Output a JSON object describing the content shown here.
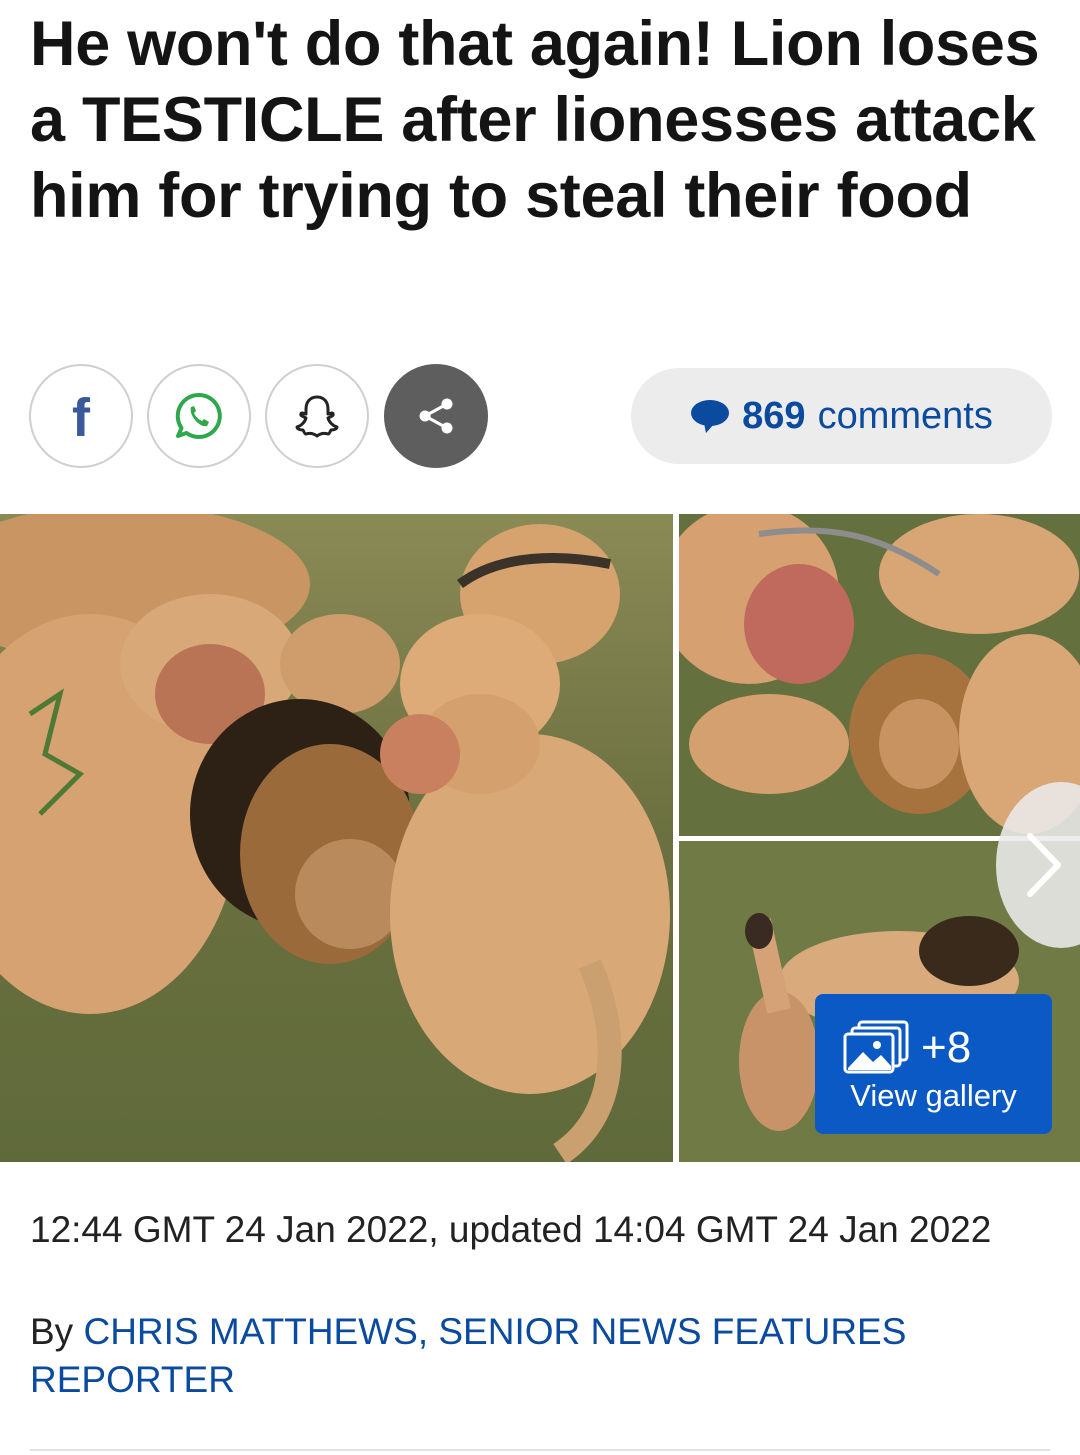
{
  "article": {
    "headline": "He won't do that again! Lion loses a TESTICLE after lionesses attack him for trying to steal their food",
    "timestamp": "12:44 GMT 24 Jan 2022, updated 14:04 GMT 24 Jan 2022",
    "byline_prefix": "By",
    "author": "CHRIS MATTHEWS, SENIOR NEWS FEATURES REPORTER"
  },
  "share": {
    "buttons": [
      {
        "name": "facebook",
        "icon": "facebook-icon",
        "glyph": "f"
      },
      {
        "name": "whatsapp",
        "icon": "whatsapp-icon"
      },
      {
        "name": "snapchat",
        "icon": "snapchat-icon"
      },
      {
        "name": "more",
        "icon": "share-icon"
      }
    ],
    "comments_count": "869",
    "comments_label": "comments"
  },
  "gallery": {
    "extra_count": "+8",
    "view_label": "View gallery",
    "next_icon": "chevron-right-icon"
  },
  "colors": {
    "link_blue": "#0a4a9f",
    "gallery_button": "#0b59c5",
    "share_more_bg": "#5e5e5e",
    "facebook": "#3b5998"
  }
}
